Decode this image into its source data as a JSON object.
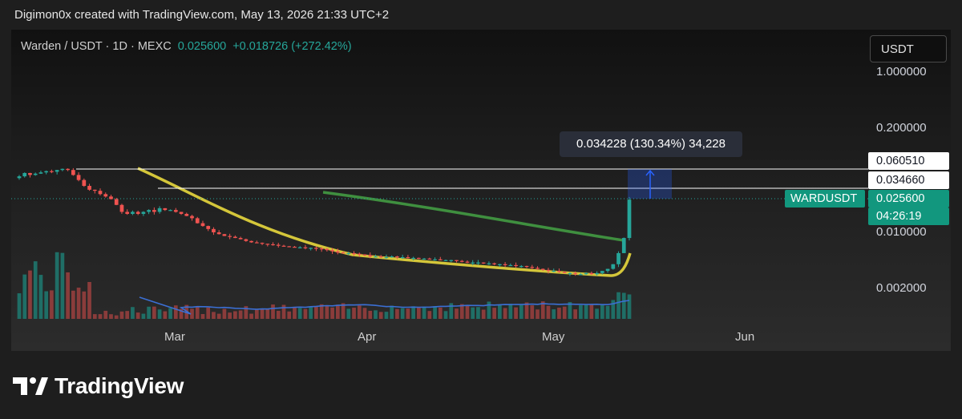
{
  "header": {
    "credit": "Digimon0x created with TradingView.com, May 13, 2026 21:33 UTC+2"
  },
  "symbol": {
    "title": "Warden / USDT · 1D · MEXC",
    "price": "0.025600",
    "change": "+0.018726 (+272.42%)"
  },
  "currency_button": "USDT",
  "price_axis": {
    "scale": "log",
    "ticks": [
      "1.000000",
      "0.200000",
      "0.010000",
      "0.002000"
    ]
  },
  "labels": {
    "upper_level": "0.060510",
    "lower_level": "0.034660",
    "symbol_tag": "WARDUSDT",
    "last_price": "0.025600",
    "countdown": "04:26:19"
  },
  "measure_tooltip": "0.034228 (130.34%) 34,228",
  "time_axis": [
    "Mar",
    "Apr",
    "May",
    "Jun"
  ],
  "brand": "TradingView",
  "colors": {
    "up": "#26a69a",
    "down": "#ef5350",
    "ma_yellow": "#d4c63a",
    "ma_green": "#3f8f3f",
    "volume_ma": "#3b6fd4",
    "measure": "#2962ff"
  },
  "chart_data": {
    "type": "candlestick",
    "y_scale": "log",
    "x_range": [
      "2026-02-10",
      "2026-06-10"
    ],
    "candles_close": [
      0.05,
      0.055,
      0.052,
      0.054,
      0.056,
      0.058,
      0.057,
      0.06,
      0.062,
      0.06,
      0.052,
      0.045,
      0.038,
      0.034,
      0.033,
      0.03,
      0.028,
      0.026,
      0.022,
      0.018,
      0.017,
      0.018,
      0.017,
      0.018,
      0.019,
      0.018,
      0.02,
      0.019,
      0.019,
      0.018,
      0.017,
      0.016,
      0.015,
      0.013,
      0.012,
      0.011,
      0.01,
      0.0095,
      0.009,
      0.0088,
      0.0085,
      0.0082,
      0.0078,
      0.0075,
      0.0074,
      0.0072,
      0.0071,
      0.007,
      0.0068,
      0.0067,
      0.0066,
      0.0065,
      0.0065,
      0.0064,
      0.0064,
      0.0063,
      0.0062,
      0.006,
      0.0058,
      0.0056,
      0.0055,
      0.0055,
      0.0054,
      0.0053,
      0.0052,
      0.005,
      0.005,
      0.0049,
      0.0049,
      0.005,
      0.0049,
      0.0049,
      0.0048,
      0.0048,
      0.0047,
      0.0047,
      0.0046,
      0.0046,
      0.0045,
      0.0045,
      0.0045,
      0.0044,
      0.0043,
      0.0042,
      0.0042,
      0.0042,
      0.0041,
      0.0041,
      0.004,
      0.004,
      0.0039,
      0.0039,
      0.0038,
      0.0038,
      0.0037,
      0.0036,
      0.0035,
      0.0034,
      0.0033,
      0.0033,
      0.0032,
      0.0031,
      0.0031,
      0.003,
      0.003,
      0.0031,
      0.003,
      0.0031,
      0.0033,
      0.0035,
      0.004,
      0.0055,
      0.0085,
      0.0256
    ],
    "ma_slow_start": "2026-02-21",
    "ma_fast_start": "2026-03-20",
    "measure": {
      "from": 0.0256,
      "to": 0.06051,
      "text": "0.034228 (130.34%) 34,228"
    },
    "horizontal_lines": [
      0.06051,
      0.03466
    ]
  }
}
